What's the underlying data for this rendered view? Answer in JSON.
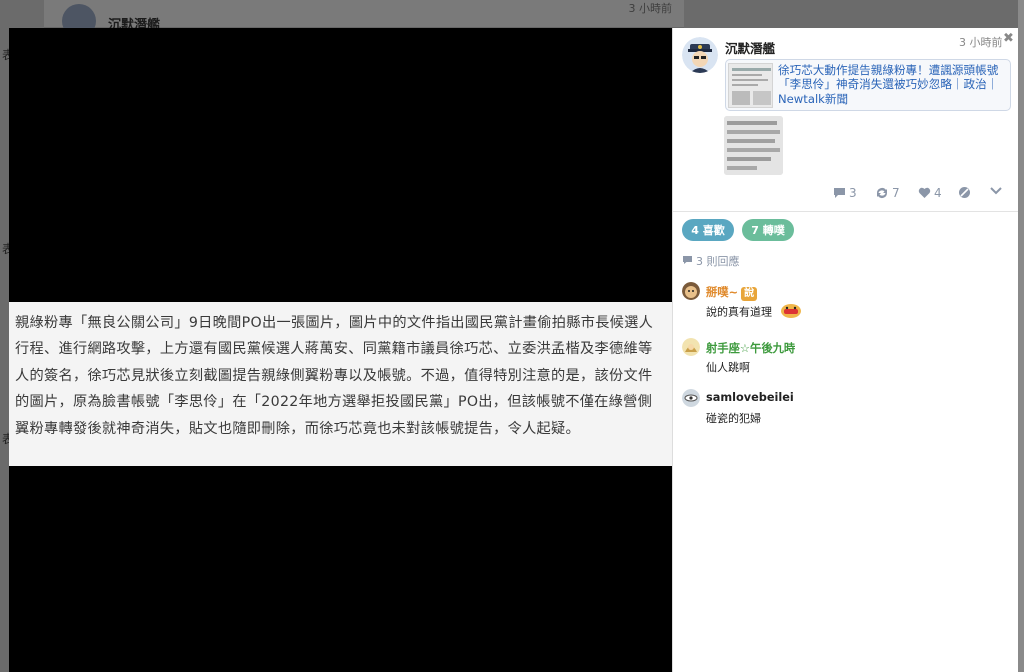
{
  "background": {
    "author": "沉默潛艦",
    "time": "3 小時前",
    "side_marks": [
      "表",
      "表",
      "表"
    ]
  },
  "article": {
    "body": "親綠粉專「無良公關公司」9日晚間PO出一張圖片，圖片中的文件指出國民黨計畫偷拍縣市長候選人行程、進行網路攻擊，上方還有國民黨候選人蔣萬安、同黨籍市議員徐巧芯、立委洪孟楷及李德維等人的簽名，徐巧芯見狀後立刻截圖提告親綠側翼粉專以及帳號。不過，值得特別注意的是，該份文件的圖片，原為臉書帳號「李思伶」在「2022年地方選舉拒投國民黨」PO出，但該帳號不僅在綠營側翼粉專轉發後就神奇消失，貼文也隨即刪除，而徐巧芯竟也未對該帳號提告，令人起疑。"
  },
  "post": {
    "author": "沉默潛艦",
    "time": "3 小時前",
    "link_title": "徐巧芯大動作提告親綠粉專！遭諷源頭帳號「李思伶」神奇消失還被巧妙忽略｜政治｜Newtalk新聞",
    "actions": {
      "comments": "3",
      "reposts": "7",
      "likes": "4"
    }
  },
  "stats": {
    "likes_label": "4 喜歡",
    "reposts_label": "7 轉噗",
    "replies_label": "3 則回應"
  },
  "comments": [
    {
      "name": "掰噗~",
      "badge": "說",
      "text": "說的真有道理",
      "name_color": "#e08a2c"
    },
    {
      "name": "射手座☆午後九時",
      "badge": "",
      "text": "仙人跳啊",
      "name_color": "#3d9a3d"
    },
    {
      "name": "samlovebeilei",
      "badge": "",
      "text": "碰瓷的犯婦",
      "name_color": "#222222"
    }
  ],
  "colors": {
    "link": "#2a64b8",
    "like_pill": "#5aa7c1",
    "share_pill": "#6bbd9b",
    "meta": "#8b96a8"
  }
}
